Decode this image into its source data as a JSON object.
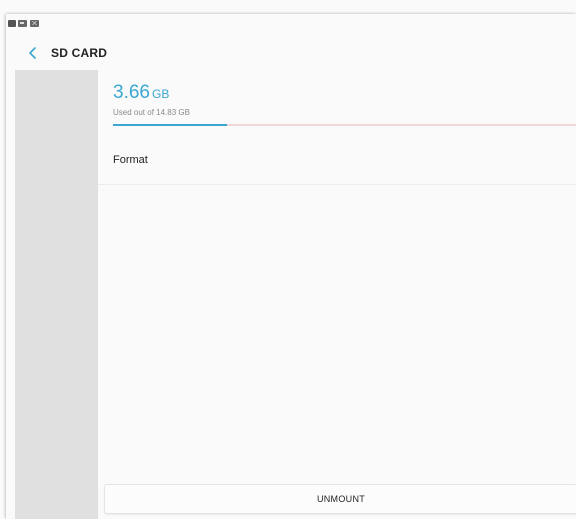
{
  "header": {
    "title": "SD CARD"
  },
  "storage": {
    "used_value": "3.66",
    "used_unit": "GB",
    "caption": "Used out of 14.83 GB",
    "used_fraction": 0.2468
  },
  "menu": {
    "format_label": "Format"
  },
  "footer": {
    "unmount_label": "UNMOUNT"
  },
  "colors": {
    "accent": "#3aa7d0",
    "bar_remaining": "#f0d8d8",
    "side_panel": "#e0e0e0",
    "background": "#fafafa"
  },
  "icons": {
    "status": [
      "sd-card-icon",
      "image-icon",
      "mail-icon"
    ],
    "back": "chevron-left-icon"
  }
}
